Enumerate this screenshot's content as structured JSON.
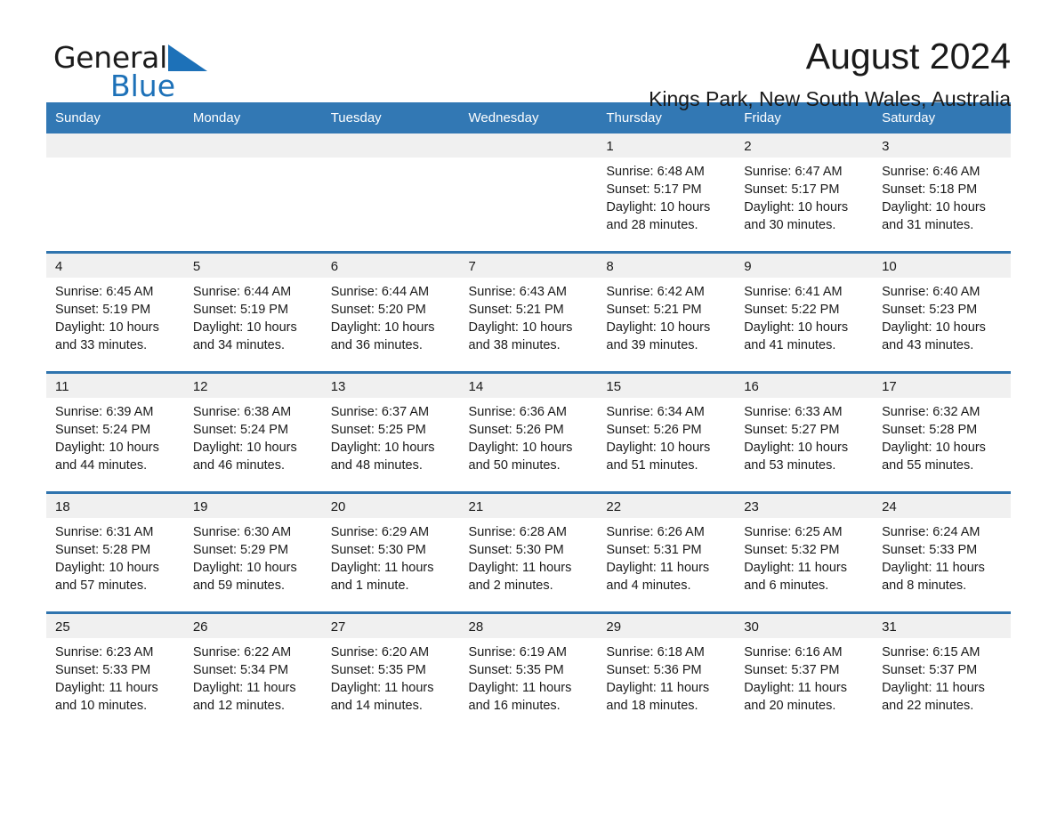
{
  "brand": {
    "word1": "General",
    "word2": "Blue",
    "triangle_color": "#1d71b8",
    "text_color": "#1b1b1b"
  },
  "header": {
    "month_title": "August 2024",
    "location": "Kings Park, New South Wales, Australia"
  },
  "colors": {
    "header_blue": "#3278b4",
    "row_divider_blue": "#2f74ae",
    "day_strip_gray": "#f0f0f0",
    "text": "#1a1a1a"
  },
  "weekdays": [
    "Sunday",
    "Monday",
    "Tuesday",
    "Wednesday",
    "Thursday",
    "Friday",
    "Saturday"
  ],
  "labels": {
    "sunrise_prefix": "Sunrise:",
    "sunset_prefix": "Sunset:",
    "daylight_prefix": "Daylight:"
  },
  "weeks": [
    [
      {
        "day": "",
        "empty": true
      },
      {
        "day": "",
        "empty": true
      },
      {
        "day": "",
        "empty": true
      },
      {
        "day": "",
        "empty": true
      },
      {
        "day": "1",
        "sunrise": "Sunrise: 6:48 AM",
        "sunset": "Sunset: 5:17 PM",
        "daylight": "Daylight: 10 hours and 28 minutes."
      },
      {
        "day": "2",
        "sunrise": "Sunrise: 6:47 AM",
        "sunset": "Sunset: 5:17 PM",
        "daylight": "Daylight: 10 hours and 30 minutes."
      },
      {
        "day": "3",
        "sunrise": "Sunrise: 6:46 AM",
        "sunset": "Sunset: 5:18 PM",
        "daylight": "Daylight: 10 hours and 31 minutes."
      }
    ],
    [
      {
        "day": "4",
        "sunrise": "Sunrise: 6:45 AM",
        "sunset": "Sunset: 5:19 PM",
        "daylight": "Daylight: 10 hours and 33 minutes."
      },
      {
        "day": "5",
        "sunrise": "Sunrise: 6:44 AM",
        "sunset": "Sunset: 5:19 PM",
        "daylight": "Daylight: 10 hours and 34 minutes."
      },
      {
        "day": "6",
        "sunrise": "Sunrise: 6:44 AM",
        "sunset": "Sunset: 5:20 PM",
        "daylight": "Daylight: 10 hours and 36 minutes."
      },
      {
        "day": "7",
        "sunrise": "Sunrise: 6:43 AM",
        "sunset": "Sunset: 5:21 PM",
        "daylight": "Daylight: 10 hours and 38 minutes."
      },
      {
        "day": "8",
        "sunrise": "Sunrise: 6:42 AM",
        "sunset": "Sunset: 5:21 PM",
        "daylight": "Daylight: 10 hours and 39 minutes."
      },
      {
        "day": "9",
        "sunrise": "Sunrise: 6:41 AM",
        "sunset": "Sunset: 5:22 PM",
        "daylight": "Daylight: 10 hours and 41 minutes."
      },
      {
        "day": "10",
        "sunrise": "Sunrise: 6:40 AM",
        "sunset": "Sunset: 5:23 PM",
        "daylight": "Daylight: 10 hours and 43 minutes."
      }
    ],
    [
      {
        "day": "11",
        "sunrise": "Sunrise: 6:39 AM",
        "sunset": "Sunset: 5:24 PM",
        "daylight": "Daylight: 10 hours and 44 minutes."
      },
      {
        "day": "12",
        "sunrise": "Sunrise: 6:38 AM",
        "sunset": "Sunset: 5:24 PM",
        "daylight": "Daylight: 10 hours and 46 minutes."
      },
      {
        "day": "13",
        "sunrise": "Sunrise: 6:37 AM",
        "sunset": "Sunset: 5:25 PM",
        "daylight": "Daylight: 10 hours and 48 minutes."
      },
      {
        "day": "14",
        "sunrise": "Sunrise: 6:36 AM",
        "sunset": "Sunset: 5:26 PM",
        "daylight": "Daylight: 10 hours and 50 minutes."
      },
      {
        "day": "15",
        "sunrise": "Sunrise: 6:34 AM",
        "sunset": "Sunset: 5:26 PM",
        "daylight": "Daylight: 10 hours and 51 minutes."
      },
      {
        "day": "16",
        "sunrise": "Sunrise: 6:33 AM",
        "sunset": "Sunset: 5:27 PM",
        "daylight": "Daylight: 10 hours and 53 minutes."
      },
      {
        "day": "17",
        "sunrise": "Sunrise: 6:32 AM",
        "sunset": "Sunset: 5:28 PM",
        "daylight": "Daylight: 10 hours and 55 minutes."
      }
    ],
    [
      {
        "day": "18",
        "sunrise": "Sunrise: 6:31 AM",
        "sunset": "Sunset: 5:28 PM",
        "daylight": "Daylight: 10 hours and 57 minutes."
      },
      {
        "day": "19",
        "sunrise": "Sunrise: 6:30 AM",
        "sunset": "Sunset: 5:29 PM",
        "daylight": "Daylight: 10 hours and 59 minutes."
      },
      {
        "day": "20",
        "sunrise": "Sunrise: 6:29 AM",
        "sunset": "Sunset: 5:30 PM",
        "daylight": "Daylight: 11 hours and 1 minute."
      },
      {
        "day": "21",
        "sunrise": "Sunrise: 6:28 AM",
        "sunset": "Sunset: 5:30 PM",
        "daylight": "Daylight: 11 hours and 2 minutes."
      },
      {
        "day": "22",
        "sunrise": "Sunrise: 6:26 AM",
        "sunset": "Sunset: 5:31 PM",
        "daylight": "Daylight: 11 hours and 4 minutes."
      },
      {
        "day": "23",
        "sunrise": "Sunrise: 6:25 AM",
        "sunset": "Sunset: 5:32 PM",
        "daylight": "Daylight: 11 hours and 6 minutes."
      },
      {
        "day": "24",
        "sunrise": "Sunrise: 6:24 AM",
        "sunset": "Sunset: 5:33 PM",
        "daylight": "Daylight: 11 hours and 8 minutes."
      }
    ],
    [
      {
        "day": "25",
        "sunrise": "Sunrise: 6:23 AM",
        "sunset": "Sunset: 5:33 PM",
        "daylight": "Daylight: 11 hours and 10 minutes."
      },
      {
        "day": "26",
        "sunrise": "Sunrise: 6:22 AM",
        "sunset": "Sunset: 5:34 PM",
        "daylight": "Daylight: 11 hours and 12 minutes."
      },
      {
        "day": "27",
        "sunrise": "Sunrise: 6:20 AM",
        "sunset": "Sunset: 5:35 PM",
        "daylight": "Daylight: 11 hours and 14 minutes."
      },
      {
        "day": "28",
        "sunrise": "Sunrise: 6:19 AM",
        "sunset": "Sunset: 5:35 PM",
        "daylight": "Daylight: 11 hours and 16 minutes."
      },
      {
        "day": "29",
        "sunrise": "Sunrise: 6:18 AM",
        "sunset": "Sunset: 5:36 PM",
        "daylight": "Daylight: 11 hours and 18 minutes."
      },
      {
        "day": "30",
        "sunrise": "Sunrise: 6:16 AM",
        "sunset": "Sunset: 5:37 PM",
        "daylight": "Daylight: 11 hours and 20 minutes."
      },
      {
        "day": "31",
        "sunrise": "Sunrise: 6:15 AM",
        "sunset": "Sunset: 5:37 PM",
        "daylight": "Daylight: 11 hours and 22 minutes."
      }
    ]
  ]
}
